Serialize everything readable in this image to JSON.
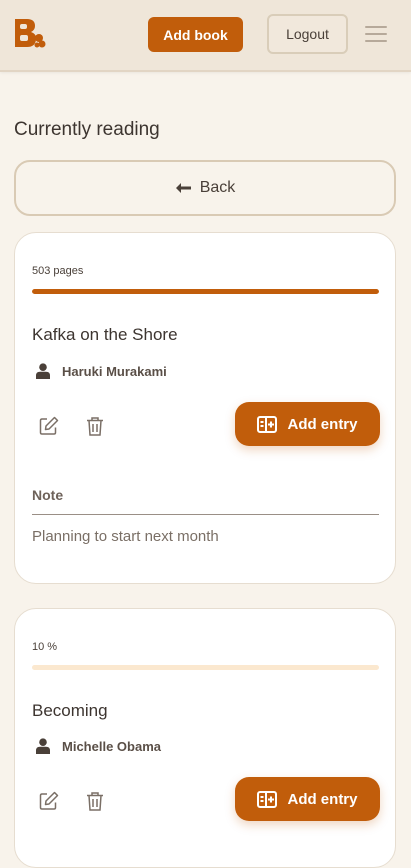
{
  "header": {
    "add_book_label": "Add book",
    "logout_label": "Logout"
  },
  "page": {
    "title": "Currently reading",
    "back_label": "Back"
  },
  "books": [
    {
      "progress_text": "503 pages",
      "progress_fraction": 1.0,
      "title": "Kafka on the Shore",
      "author": "Haruki Murakami",
      "add_entry_label": "Add entry",
      "note_label": "Note",
      "note_text": "Planning to start next month"
    },
    {
      "progress_text": "10 %",
      "progress_fraction": 0.0,
      "title": "Becoming",
      "author": "Michelle Obama",
      "add_entry_label": "Add entry"
    }
  ],
  "colors": {
    "accent": "#c15d0b",
    "background": "#f8f3eb",
    "header_background": "#efe6d9",
    "progress_track": "#fbe8cf"
  },
  "icons": [
    "brand-logo-icon",
    "menu-icon",
    "back-arrow-icon",
    "user-icon",
    "edit-icon",
    "trash-icon",
    "add-entry-icon"
  ]
}
